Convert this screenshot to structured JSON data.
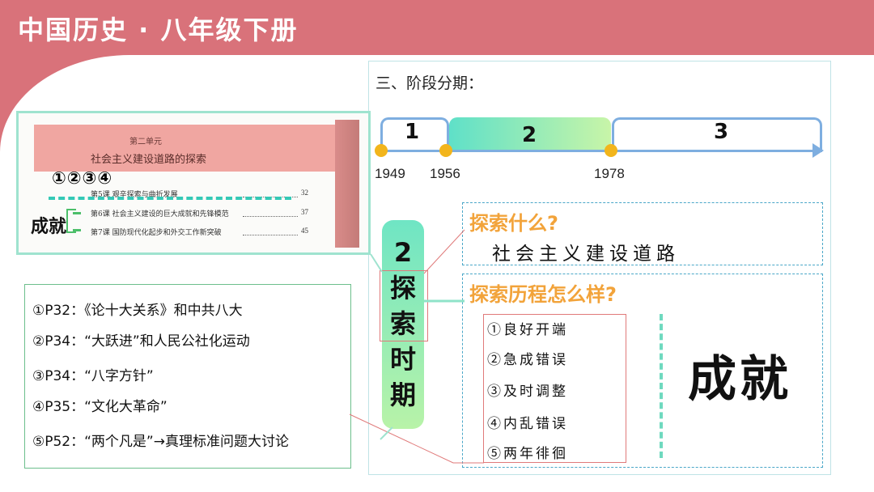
{
  "header": {
    "title": "中国历史 · 八年级下册"
  },
  "stage": {
    "title": "三、阶段分期：",
    "segments": [
      "1",
      "2",
      "3"
    ],
    "years": [
      "1949",
      "1956",
      "1978"
    ]
  },
  "textbook": {
    "unit_label": "第二单元",
    "unit_title": "社会主义建设道路的探索",
    "toc": [
      {
        "text": "第5课  艰辛探索与曲折发展",
        "page": "32"
      },
      {
        "text": "第6课  社会主义建设的巨大成就和先锋模范",
        "page": "37"
      },
      {
        "text": "第7课  国防现代化起步和外交工作新突破",
        "page": "45"
      }
    ]
  },
  "annotation": {
    "circles": "①②③④",
    "achievement_label": "成就"
  },
  "list_items": [
    "①P32：《论十大关系》和中共八大",
    "②P34：“大跃进”和人民公社化运动",
    "③P34：“八字方针”",
    "④P35：“文化大革命”",
    "⑤P52：“两个凡是”→真理标准问题大讨论"
  ],
  "period": {
    "number": "2",
    "chars": [
      "探",
      "索",
      "时",
      "期"
    ]
  },
  "explore_what": {
    "title": "探索什么?",
    "answer": "社会主义建设道路"
  },
  "explore_process": {
    "title": "探索历程怎么样?",
    "steps": [
      "①良好开端",
      "②急成错误",
      "③及时调整",
      "④内乱错误",
      "⑤两年徘徊"
    ],
    "achievement": "成就"
  },
  "colors": {
    "header_bg": "#d9727a",
    "accent_orange": "#f2a33a",
    "timeline_blue": "#7eaee0",
    "dot_yellow": "#f2b51c"
  }
}
